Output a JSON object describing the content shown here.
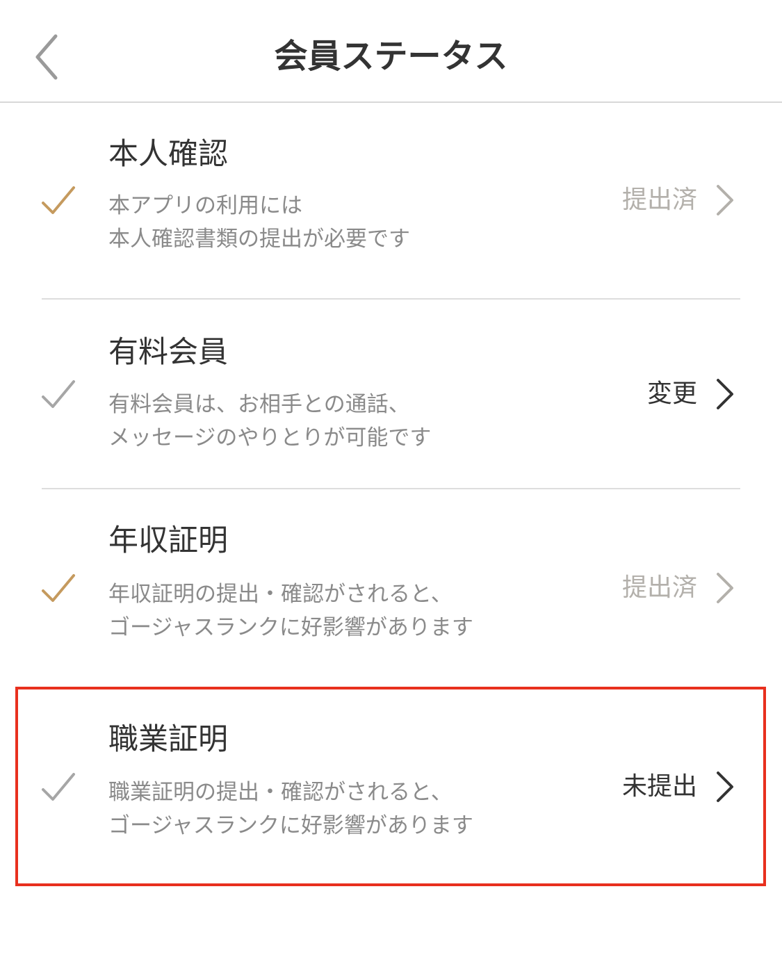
{
  "header": {
    "title": "会員ステータス",
    "back_icon": "chevron-left-icon"
  },
  "colors": {
    "check_done": "#c59a5e",
    "check_pending": "#a6a6a6",
    "status_done": "#b3b0ab",
    "status_active": "#333333",
    "highlight": "#e8301e"
  },
  "items": [
    {
      "title": "本人確認",
      "desc": [
        "本アプリの利用には",
        "本人確認書類の提出が必要です"
      ],
      "status": "提出済",
      "state": "done"
    },
    {
      "title": "有料会員",
      "desc": [
        "有料会員は、お相手との通話、",
        "メッセージのやりとりが可能です"
      ],
      "status": "変更",
      "state": "active"
    },
    {
      "title": "年収証明",
      "desc": [
        "年収証明の提出・確認がされると、",
        "ゴージャスランクに好影響があります"
      ],
      "status": "提出済",
      "state": "done"
    },
    {
      "title": "職業証明",
      "desc": [
        "職業証明の提出・確認がされると、",
        "ゴージャスランクに好影響があります"
      ],
      "status": "未提出",
      "state": "active"
    }
  ]
}
